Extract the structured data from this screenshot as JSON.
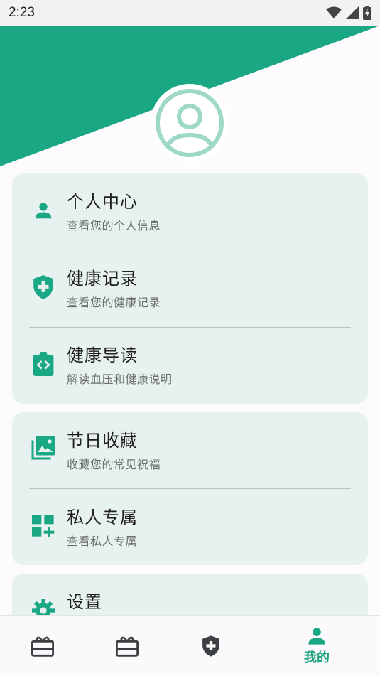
{
  "status": {
    "time": "2:23"
  },
  "colors": {
    "primary": "#1aa784",
    "avatar": "#9dd8c8",
    "card": "#e7f1f0"
  },
  "menu_card_1": [
    {
      "title": "个人中心",
      "subtitle": "查看您的个人信息",
      "icon": "person-icon"
    },
    {
      "title": "健康记录",
      "subtitle": "查看您的健康记录",
      "icon": "medical-shield-icon"
    },
    {
      "title": "健康导读",
      "subtitle": "解读血压和健康说明",
      "icon": "clipboard-code-icon"
    }
  ],
  "menu_card_2": [
    {
      "title": "节日收藏",
      "subtitle": "收藏您的常见祝福",
      "icon": "photo-library-icon"
    },
    {
      "title": "私人专属",
      "subtitle": "查看私人专属",
      "icon": "dashboard-add-icon"
    }
  ],
  "menu_card_3": [
    {
      "title": "设置",
      "icon": "gear-icon"
    }
  ],
  "bottom_nav": [
    {
      "icon": "gift-card-icon",
      "label": ""
    },
    {
      "icon": "gift-card-icon",
      "label": ""
    },
    {
      "icon": "medical-shield-icon",
      "label": ""
    },
    {
      "icon": "person-icon",
      "label": "我的",
      "active": true
    }
  ]
}
